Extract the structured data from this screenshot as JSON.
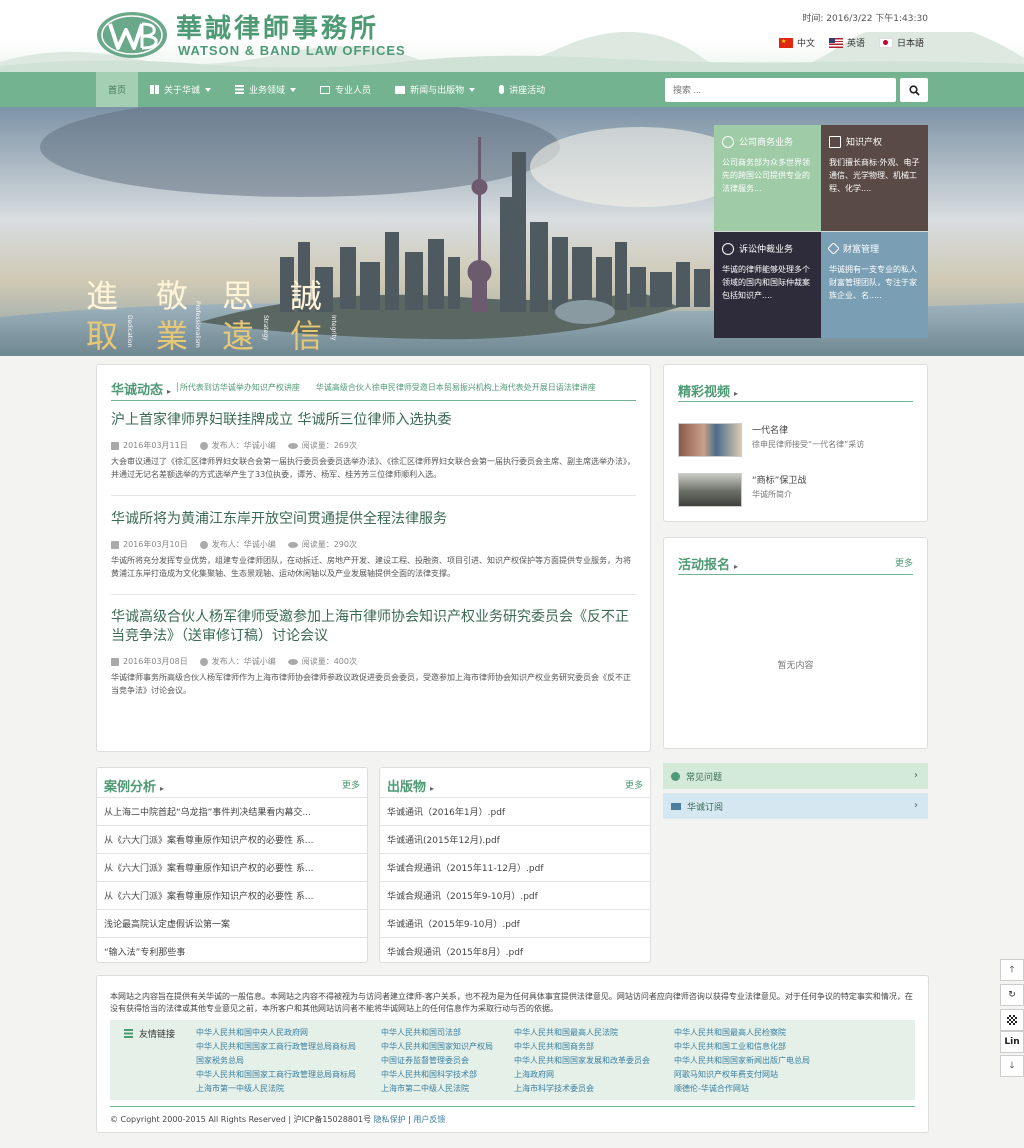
{
  "header": {
    "cn_name": "華誠律師事務所",
    "en_name": "WATSON & BAND LAW OFFICES",
    "time": "时间: 2016/3/22 下午1:43:30",
    "langs": [
      "中文",
      "英语",
      "日本語"
    ]
  },
  "nav": {
    "items": [
      "首页",
      "关于华诚",
      "业务领域",
      "专业人员",
      "新闻与出版物",
      "讲座活动"
    ],
    "search_placeholder": "搜索 ..."
  },
  "banner": {
    "slogan_chars": [
      "進",
      "敬",
      "思",
      "誠",
      "取",
      "業",
      "遠",
      "信"
    ],
    "slogan_en": [
      "Dedication",
      "Professionalism",
      "Strategy",
      "Integrity"
    ],
    "tiles": [
      {
        "title": "公司商务业务",
        "text": "公司商务部为众多世界领先的跨国公司提供专业的法律服务...",
        "color": "#9fcba7"
      },
      {
        "title": "知识产权",
        "text": "我们擅长商标·外观、电子通信、光学物理、机械工程、化学....",
        "color": "#5a4a45"
      },
      {
        "title": "诉讼仲裁业务",
        "text": "华诚的律师能够处理多个领域的国内和国际仲裁案包括知识产....",
        "color": "#2e2c3a"
      },
      {
        "title": "财富管理",
        "text": "华诚拥有一支专业的私人财富管理团队，专注于家族企业、名.....",
        "color": "#7a9fb4"
      }
    ]
  },
  "news": {
    "title": "华诚动态",
    "ticker": "│所代表到访华诚举办知识产权讲座　　华诚高级合伙人徐申民律师受邀日本贸易振兴机构上海代表处开展日语法律讲座",
    "items": [
      {
        "title": "沪上首家律师界妇联挂牌成立 华诚所三位律师入选执委",
        "date": "2016年03月11日",
        "author": "发布人：华诚小编",
        "views": "阅读量：269次",
        "summary": "大会审议通过了《徐汇区律师界妇女联合会第一届执行委员会委员选举办法》、《徐汇区律师界妇女联合会第一届执行委员会主席、副主席选举办法》，并通过无记名差额选举的方式选举产生了33位执委，谭芳、杨军、桂芳芳三位律师顺利入选。"
      },
      {
        "title": "华诚所将为黄浦江东岸开放空间贯通提供全程法律服务",
        "date": "2016年03月10日",
        "author": "发布人：华诚小编",
        "views": "阅读量：290次",
        "summary": "华诚所将充分发挥专业优势，组建专业律师团队，在动拆迁、房地产开发、建设工程、投融资、项目引进、知识产权保护等方面提供专业服务，为将黄浦江东岸打造成为文化集聚轴、生态景观轴、运动休闲轴以及产业发展轴提供全面的法律支撑。"
      },
      {
        "title": "华诚高级合伙人杨军律师受邀参加上海市律师协会知识产权业务研究委员会《反不正当竞争法》（送审修订稿）讨论会议",
        "date": "2016年03月08日",
        "author": "发布人：华诚小编",
        "views": "阅读量：400次",
        "summary": "华诚律师事务所高级合伙人杨军律师作为上海市律师协会律师参政议政促进委员会委员，受邀参加上海市律师协会知识产权业务研究委员会《反不正当竞争法》讨论会议。"
      }
    ]
  },
  "videos": {
    "title": "精彩视频",
    "items": [
      {
        "title": "一代名律",
        "sub": "徐申民律师接受“一代名律”采访"
      },
      {
        "title": "“商标”保卫战",
        "sub": "华诚所简介"
      }
    ]
  },
  "events": {
    "title": "活动报名",
    "more": "更多",
    "empty": "暂无内容"
  },
  "cases": {
    "title": "案例分析",
    "more": "更多",
    "items": [
      "从上海二中院首起“乌龙指”事件判决结果看内幕交...",
      "从《六大门派》案看尊重原作知识产权的必要性 系...",
      "从《六大门派》案看尊重原作知识产权的必要性 系...",
      "从《六大门派》案看尊重原作知识产权的必要性 系...",
      "浅论最高院认定虚假诉讼第一案",
      "“输入法”专利那些事"
    ]
  },
  "publications": {
    "title": "出版物",
    "more": "更多",
    "items": [
      "华诚通讯（2016年1月）.pdf",
      "华诚通讯(2015年12月).pdf",
      "华诚合规通讯（2015年11-12月）.pdf",
      "华诚合规通讯（2015年9-10月）.pdf",
      "华诚通讯（2015年9-10月）.pdf",
      "华诚合规通讯（2015年8月）.pdf"
    ]
  },
  "side_buttons": [
    "常见问题",
    "华诚订阅"
  ],
  "footer": {
    "disclaimer": "本网站之内容旨在提供有关华诚的一般信息。本网站之内容不得被视为与访问者建立律师-客户关系，也不视为是为任何具体事宜提供法律意见。网站访问者应向律师咨询以获得专业法律意见。对于任何争议的特定事实和情况，在没有获得恰当的法律或其他专业意见之前，本所客户和其他网站访问者不能将华诚网站上的任何信息作为采取行动与否的依据。",
    "links_title": "友情链接",
    "links": [
      "中华人民共和国中央人民政府网",
      "中华人民共和国司法部",
      "中华人民共和国最高人民法院",
      "中华人民共和国最高人民检察院",
      "中华人民共和国国家工商行政管理总局商标局",
      "中华人民共和国国家知识产权局",
      "中华人民共和国商务部",
      "中华人民共和国工业和信息化部",
      "国家税务总局",
      "中国证券监督管理委员会",
      "中华人民共和国国家发展和改革委员会",
      "中华人民共和国国家新闻出版广电总局",
      "中华人民共和国国家工商行政管理总局商标局",
      "中华人民共和国科学技术部",
      "上海政府网",
      "阿歌马知识产权年费支付网站",
      "上海市第一中级人民法院",
      "上海市第二中级人民法院",
      "上海市科学技术委员会",
      "顺德伦-华诚合作网站"
    ],
    "copyright": "© Copyright 2000-2015 All Rights Reserved | 沪ICP备15028801号",
    "privacy": "隐私保护",
    "feedback": "用户反馈"
  },
  "float": {
    "lin": "Lin"
  }
}
